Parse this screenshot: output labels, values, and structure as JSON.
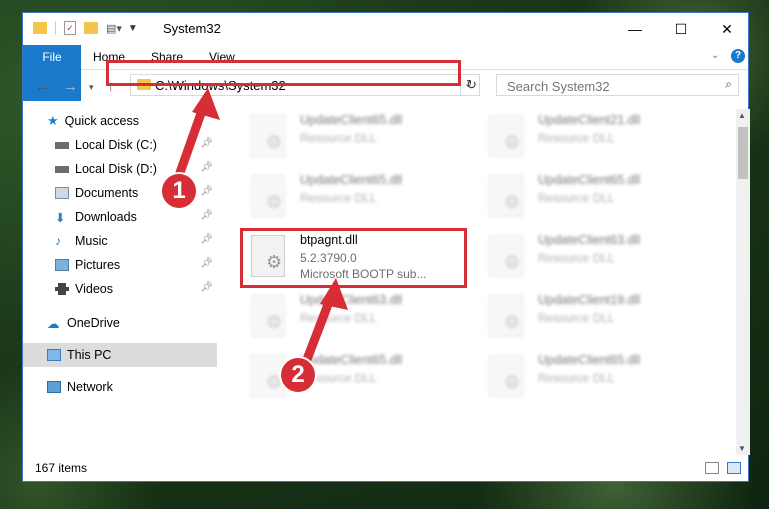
{
  "window": {
    "title": "System32",
    "buttons": {
      "minimize": "—",
      "maximize": "☐",
      "close": "✕"
    }
  },
  "ribbon": {
    "tabs": [
      "File",
      "Home",
      "Share",
      "View"
    ]
  },
  "address": {
    "path": "C:\\Windows\\System32"
  },
  "search": {
    "placeholder": "Search System32"
  },
  "sidebar": {
    "items": [
      {
        "label": "Quick access",
        "icon": "star-icon"
      },
      {
        "label": "Local Disk (C:)",
        "icon": "drive-icon"
      },
      {
        "label": "Local Disk (D:)",
        "icon": "drive-icon"
      },
      {
        "label": "Documents",
        "icon": "documents-icon"
      },
      {
        "label": "Downloads",
        "icon": "downloads-icon"
      },
      {
        "label": "Music",
        "icon": "music-icon"
      },
      {
        "label": "Pictures",
        "icon": "pictures-icon"
      },
      {
        "label": "Videos",
        "icon": "videos-icon"
      },
      {
        "label": "OneDrive",
        "icon": "cloud-icon"
      },
      {
        "label": "This PC",
        "icon": "computer-icon"
      },
      {
        "label": "Network",
        "icon": "network-icon"
      }
    ]
  },
  "files": [
    {
      "name": "UpdateClient65.dll",
      "line2": "Resource DLL",
      "line3": ""
    },
    {
      "name": "UpdateClient21.dll",
      "line2": "Resource DLL",
      "line3": ""
    },
    {
      "name": "UpdateClient65.dll",
      "line2": "Resource DLL",
      "line3": ""
    },
    {
      "name": "UpdateClient65.dll",
      "line2": "Resource DLL",
      "line3": ""
    },
    {
      "name": "btpagnt.dll",
      "line2": "5.2.3790.0",
      "line3": "Microsoft BOOTP sub..."
    },
    {
      "name": "UpdateClient63.dll",
      "line2": "Resource DLL",
      "line3": ""
    },
    {
      "name": "UpdateClient63.dll",
      "line2": "Resource DLL",
      "line3": ""
    },
    {
      "name": "UpdateClient19.dll",
      "line2": "Resource DLL",
      "line3": ""
    },
    {
      "name": "UpdateClient65.dll",
      "line2": "Resource DLL",
      "line3": ""
    },
    {
      "name": "UpdateClient65.dll",
      "line2": "Resource DLL",
      "line3": ""
    }
  ],
  "status": {
    "count": "167 items"
  },
  "annotations": {
    "step1": "1",
    "step2": "2",
    "accent": "#d62d36"
  }
}
